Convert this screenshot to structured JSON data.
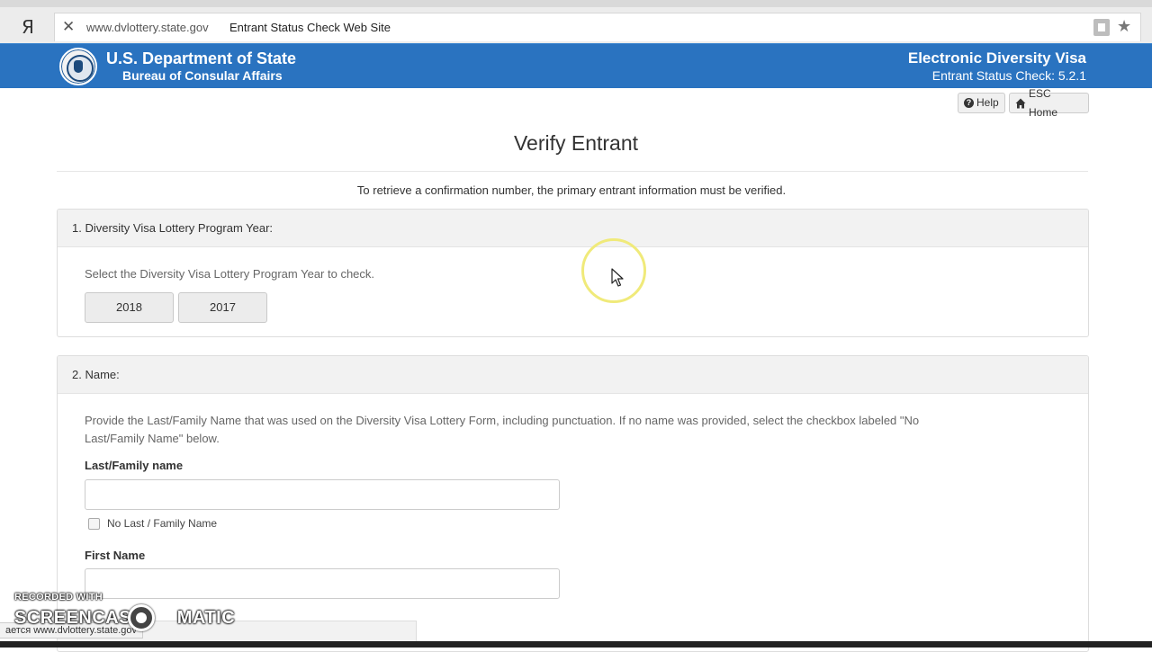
{
  "browser": {
    "logo": "Я",
    "close_glyph": "✕",
    "url_domain": "www.dvlottery.state.gov",
    "page_title": "Entrant Status Check Web Site",
    "star_glyph": "★"
  },
  "header": {
    "department": "U.S. Department of State",
    "bureau": "Bureau of Consular Affairs",
    "app_title": "Electronic Diversity Visa",
    "app_version": "Entrant Status Check: 5.2.1",
    "background_color": "#2a73c0"
  },
  "toolbar": {
    "help_label": "Help",
    "home_label": "ESC Home"
  },
  "main": {
    "title": "Verify Entrant",
    "intro": "To retrieve a confirmation number, the primary entrant information must be verified."
  },
  "section_year": {
    "heading": "1. Diversity Visa Lottery Program Year:",
    "instruction": "Select the Diversity Visa Lottery Program Year to check.",
    "options": [
      "2018",
      "2017"
    ]
  },
  "section_name": {
    "heading": "2. Name:",
    "instruction_line1": "Provide the Last/Family Name that was used on the Diversity Visa Lottery Form, including punctuation. If no name was provided, select the checkbox labeled \"No",
    "instruction_line2": "Last/Family Name\" below.",
    "last_name_label": "Last/Family name",
    "last_name_value": "",
    "no_last_name_label": "No Last / Family Name",
    "first_name_label": "First Name",
    "first_name_value": ""
  },
  "overlay": {
    "status_text": "ается www.dvlottery.state.gov",
    "recorder_small": "RECORDED WITH",
    "recorder_big": "SCREENCAST",
    "recorder_big_tail": "MATIC"
  },
  "icons": {
    "help": "question-circle-icon",
    "home": "home-icon",
    "cursor": "arrow-cursor-icon"
  }
}
